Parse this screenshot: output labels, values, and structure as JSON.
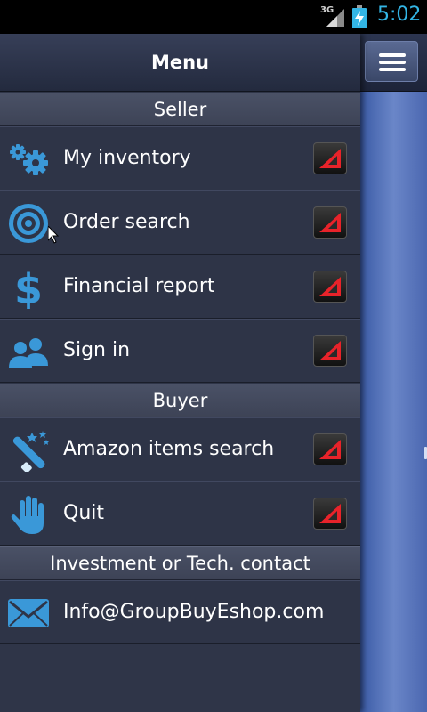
{
  "status_bar": {
    "network": "3G",
    "time": "5:02",
    "icons": [
      "signal-icon",
      "battery-charging-icon"
    ]
  },
  "drawer": {
    "title": "Menu"
  },
  "sections": [
    {
      "label": "Seller",
      "items": [
        {
          "label": "My inventory",
          "icon": "gears-icon"
        },
        {
          "label": "Order search",
          "icon": "target-icon"
        },
        {
          "label": "Financial report",
          "icon": "dollar-icon"
        },
        {
          "label": "Sign in",
          "icon": "users-icon"
        }
      ]
    },
    {
      "label": "Buyer",
      "items": [
        {
          "label": "Amazon items search",
          "icon": "magic-wand-icon"
        },
        {
          "label": "Quit",
          "icon": "hand-icon"
        }
      ]
    },
    {
      "label": "Investment or Tech. contact",
      "items": [
        {
          "label": "Info@GroupBuyEshop.com",
          "icon": "envelope-icon"
        }
      ]
    }
  ],
  "colors": {
    "accent": "#33b5e5",
    "icon_blue": "#3a98d8",
    "arrow_red": "#e8232a"
  }
}
